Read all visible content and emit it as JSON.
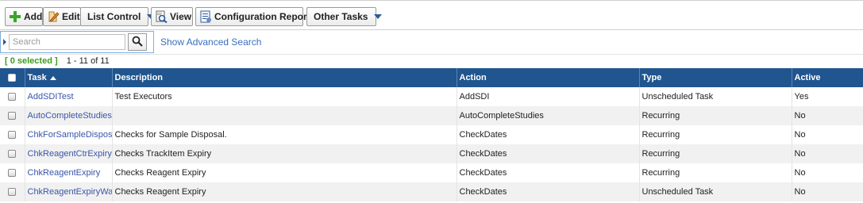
{
  "toolbar": {
    "add_label": "Add",
    "edit_label": "Edit",
    "list_control_label": "List Control",
    "view_label": "View",
    "config_report_label": "Configuration Report",
    "other_tasks_label": "Other Tasks"
  },
  "search": {
    "placeholder": "Search",
    "value": "",
    "advanced_link": "Show Advanced Search"
  },
  "selection": {
    "selected_text": "[ 0 selected ]",
    "range_text": "1 - 11 of 11"
  },
  "table": {
    "headers": {
      "task": "Task",
      "description": "Description",
      "action": "Action",
      "type": "Type",
      "active": "Active"
    },
    "rows": [
      {
        "task": "AddSDITest",
        "description": "Test Executors",
        "action": "AddSDI",
        "type": "Unscheduled Task",
        "active": "Yes"
      },
      {
        "task": "AutoCompleteStudies",
        "description": "",
        "action": "AutoCompleteStudies",
        "type": "Recurring",
        "active": "No"
      },
      {
        "task": "ChkForSampleDisposal",
        "description": "Checks for Sample Disposal.",
        "action": "CheckDates",
        "type": "Recurring",
        "active": "No"
      },
      {
        "task": "ChkReagentCtrExpiry",
        "description": "Checks TrackItem Expiry",
        "action": "CheckDates",
        "type": "Recurring",
        "active": "No"
      },
      {
        "task": "ChkReagentExpiry",
        "description": "Checks Reagent Expiry",
        "action": "CheckDates",
        "type": "Recurring",
        "active": "No"
      },
      {
        "task": "ChkReagentExpiryWarn",
        "description": "Checks Reagent Expiry",
        "action": "CheckDates",
        "type": "Unscheduled Task",
        "active": "No"
      }
    ]
  },
  "colors": {
    "header_bg": "#20558f",
    "link": "#3a55a8",
    "selected_green": "#3c9c1e",
    "caret_blue": "#2b5a9a"
  },
  "icons": {
    "add": "plus-icon",
    "edit": "edit-icon",
    "view": "view-icon",
    "config_report": "report-icon",
    "search": "magnifier-icon"
  }
}
